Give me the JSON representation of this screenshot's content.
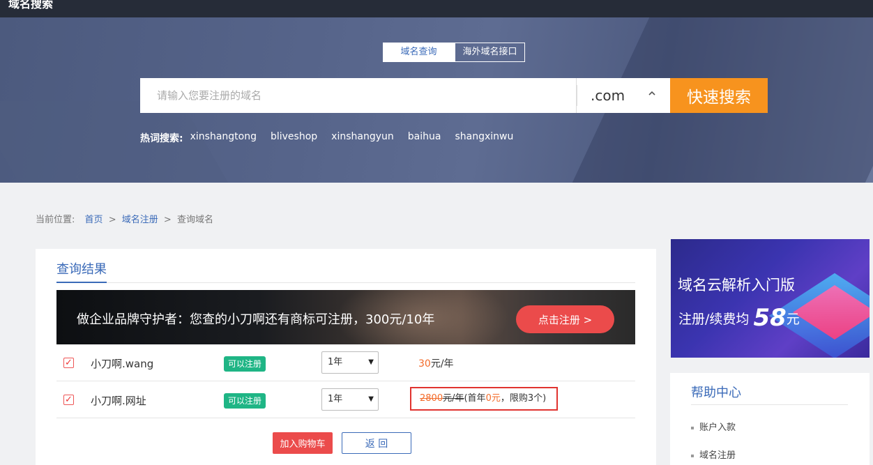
{
  "topbar": {
    "brand": "域名搜索"
  },
  "hero": {
    "tabs": [
      {
        "label": "域名查询"
      },
      {
        "label": "海外域名接口"
      }
    ],
    "search": {
      "placeholder": "请输入您要注册的域名",
      "suffix": ".com",
      "button_label": "快速搜索"
    },
    "hot": {
      "label": "热词搜索:",
      "words": [
        "xinshangtong",
        "bliveshop",
        "xinshangyun",
        "baihua",
        "shangxinwu"
      ]
    }
  },
  "breadcrumb": {
    "prefix": "当前位置:",
    "items": [
      "首页",
      "域名注册",
      "查询域名"
    ],
    "sep": ">"
  },
  "results": {
    "title": "查询结果",
    "promo_text": "做企业品牌守护者：您查的小刀啊还有商标可注册，300元/10年",
    "promo_cta": "点击注册 >",
    "rows": [
      {
        "checkbox": "✓",
        "name": "小刀啊.wang",
        "status": "可以注册",
        "period": "1年",
        "price_num": "30",
        "price_unit": "元/年"
      },
      {
        "checkbox": "✓",
        "name": "小刀啊.网址",
        "status": "可以注册",
        "period": "1年",
        "old_price": "2800",
        "old_unit": "元/年",
        "promo_a": "(首年",
        "promo_num": "0元",
        "promo_b": "，限购3个)"
      }
    ],
    "add_cart": "加入购物车",
    "back": "返 回"
  },
  "ad": {
    "line1": "域名云解析入门版",
    "line2_prefix": "注册/续费均",
    "line2_num": "58",
    "line2_suffix": "元"
  },
  "help": {
    "title": "帮助中心",
    "items": [
      "账户入款",
      "域名注册"
    ]
  },
  "colors": {
    "accent": "#3a6ab8",
    "orange": "#f7931e",
    "red": "#eb4b4b",
    "green": "#1fb585"
  }
}
